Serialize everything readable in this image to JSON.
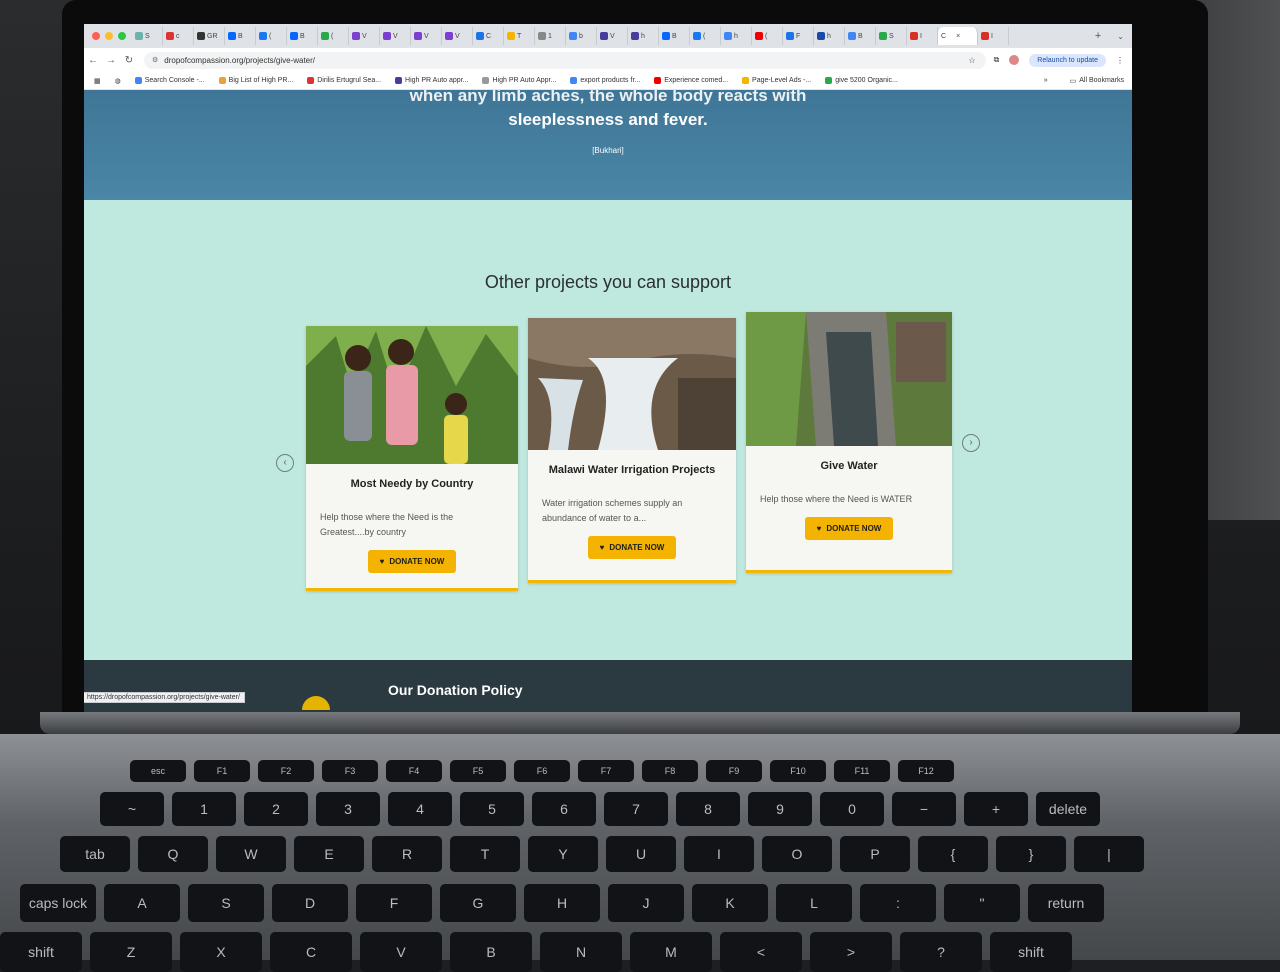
{
  "browser": {
    "active_tab_label": "C",
    "tabs": [
      {
        "label": "S",
        "color": "#6bb3a8"
      },
      {
        "label": "c",
        "color": "#d33"
      },
      {
        "label": "GR",
        "color": "#333"
      },
      {
        "label": "B",
        "color": "#0866ff"
      },
      {
        "label": "(",
        "color": "#1877f2"
      },
      {
        "label": "B",
        "color": "#0866ff"
      },
      {
        "label": "(",
        "color": "#2aa94b"
      },
      {
        "label": "V",
        "color": "#7b3fd1"
      },
      {
        "label": "V",
        "color": "#7b3fd1"
      },
      {
        "label": "V",
        "color": "#7b3fd1"
      },
      {
        "label": "V",
        "color": "#7b3fd1"
      },
      {
        "label": "C",
        "color": "#1a73e8"
      },
      {
        "label": "T",
        "color": "#f4b400"
      },
      {
        "label": "1",
        "color": "#888"
      },
      {
        "label": "b",
        "color": "#4285f4"
      },
      {
        "label": "V",
        "color": "#4a3c9e"
      },
      {
        "label": "h",
        "color": "#4a3c9e"
      },
      {
        "label": "B",
        "color": "#0866ff"
      },
      {
        "label": "(",
        "color": "#1877f2"
      },
      {
        "label": "h",
        "color": "#4285f4"
      },
      {
        "label": "(",
        "color": "#e00"
      },
      {
        "label": "F",
        "color": "#1a73e8"
      },
      {
        "label": "h",
        "color": "#1a4ba8"
      },
      {
        "label": "B",
        "color": "#4285f4"
      },
      {
        "label": "S",
        "color": "#2aa94b"
      },
      {
        "label": "I",
        "color": "#d93025"
      },
      {
        "label": "I",
        "color": "#d93025"
      }
    ],
    "new_tab": "+",
    "tab_menu": "⌄",
    "back": "←",
    "forward": "→",
    "reload": "↻",
    "url": "dropofcompassion.org/projects/give-water/",
    "star": "☆",
    "extensions": "⧉",
    "relaunch_label": "Relaunch to update",
    "menu": "⋮",
    "bookmarks": [
      {
        "label": "Search Console -...",
        "color": "#4285f4"
      },
      {
        "label": "Big List of High PR...",
        "color": "#e8a23a"
      },
      {
        "label": "Dirilis Ertugrul Sea...",
        "color": "#d33"
      },
      {
        "label": "High PR Auto appr...",
        "color": "#4a3c9e"
      },
      {
        "label": "High PR Auto Appr...",
        "color": "#999"
      },
      {
        "label": "export products fr...",
        "color": "#4285f4"
      },
      {
        "label": "Experience comed...",
        "color": "#e00"
      },
      {
        "label": "Page-Level Ads -...",
        "color": "#f4b400"
      },
      {
        "label": "give 5200 Organic...",
        "color": "#2aa94b"
      }
    ],
    "all_bookmarks": "All Bookmarks",
    "overflow": "»",
    "status_url": "https://dropofcompassion.org/projects/give-water/"
  },
  "hero": {
    "cut_line": "when any limb aches, the whole body reacts with",
    "quote": "sleeplessness and fever.",
    "citation": "[Bukhari]"
  },
  "projects": {
    "heading": "Other projects you can support",
    "prev": "‹",
    "next": "›",
    "cards": [
      {
        "title": "Most Needy by Country",
        "desc": "Help those where the Need is the Greatest....by country",
        "button": "DONATE NOW"
      },
      {
        "title": "Malawi Water Irrigation Projects",
        "desc": "Water irrigation schemes supply an abundance of water to a...",
        "button": "DONATE NOW"
      },
      {
        "title": "Give Water",
        "desc": "Help those where the Need is WATER",
        "button": "DONATE NOW"
      }
    ],
    "active_dot": 3,
    "dot_count": 6
  },
  "footer": {
    "title": "Our Donation Policy"
  },
  "keyboard": {
    "fn_row": [
      "esc",
      "F1",
      "F2",
      "F3",
      "F4",
      "F5",
      "F6",
      "F7",
      "F8",
      "F9",
      "F10",
      "F11",
      "F12"
    ],
    "num_row": [
      "~",
      "1",
      "2",
      "3",
      "4",
      "5",
      "6",
      "7",
      "8",
      "9",
      "0",
      "−",
      "+",
      "delete"
    ],
    "top_row": [
      "tab",
      "Q",
      "W",
      "E",
      "R",
      "T",
      "Y",
      "U",
      "I",
      "O",
      "P",
      "{",
      "}",
      "|"
    ],
    "home_row": [
      "caps lock",
      "A",
      "S",
      "D",
      "F",
      "G",
      "H",
      "J",
      "K",
      "L",
      ":",
      "\"",
      "return"
    ],
    "bottom_row": [
      "shift",
      "Z",
      "X",
      "C",
      "V",
      "B",
      "N",
      "M",
      "<",
      ">",
      "?",
      "shift"
    ]
  },
  "colors": {
    "hero_blue": "#3f7697",
    "mint_bg": "#bfe8de",
    "donate_yellow": "#f3b300",
    "footer_dark": "#2b3a40"
  }
}
